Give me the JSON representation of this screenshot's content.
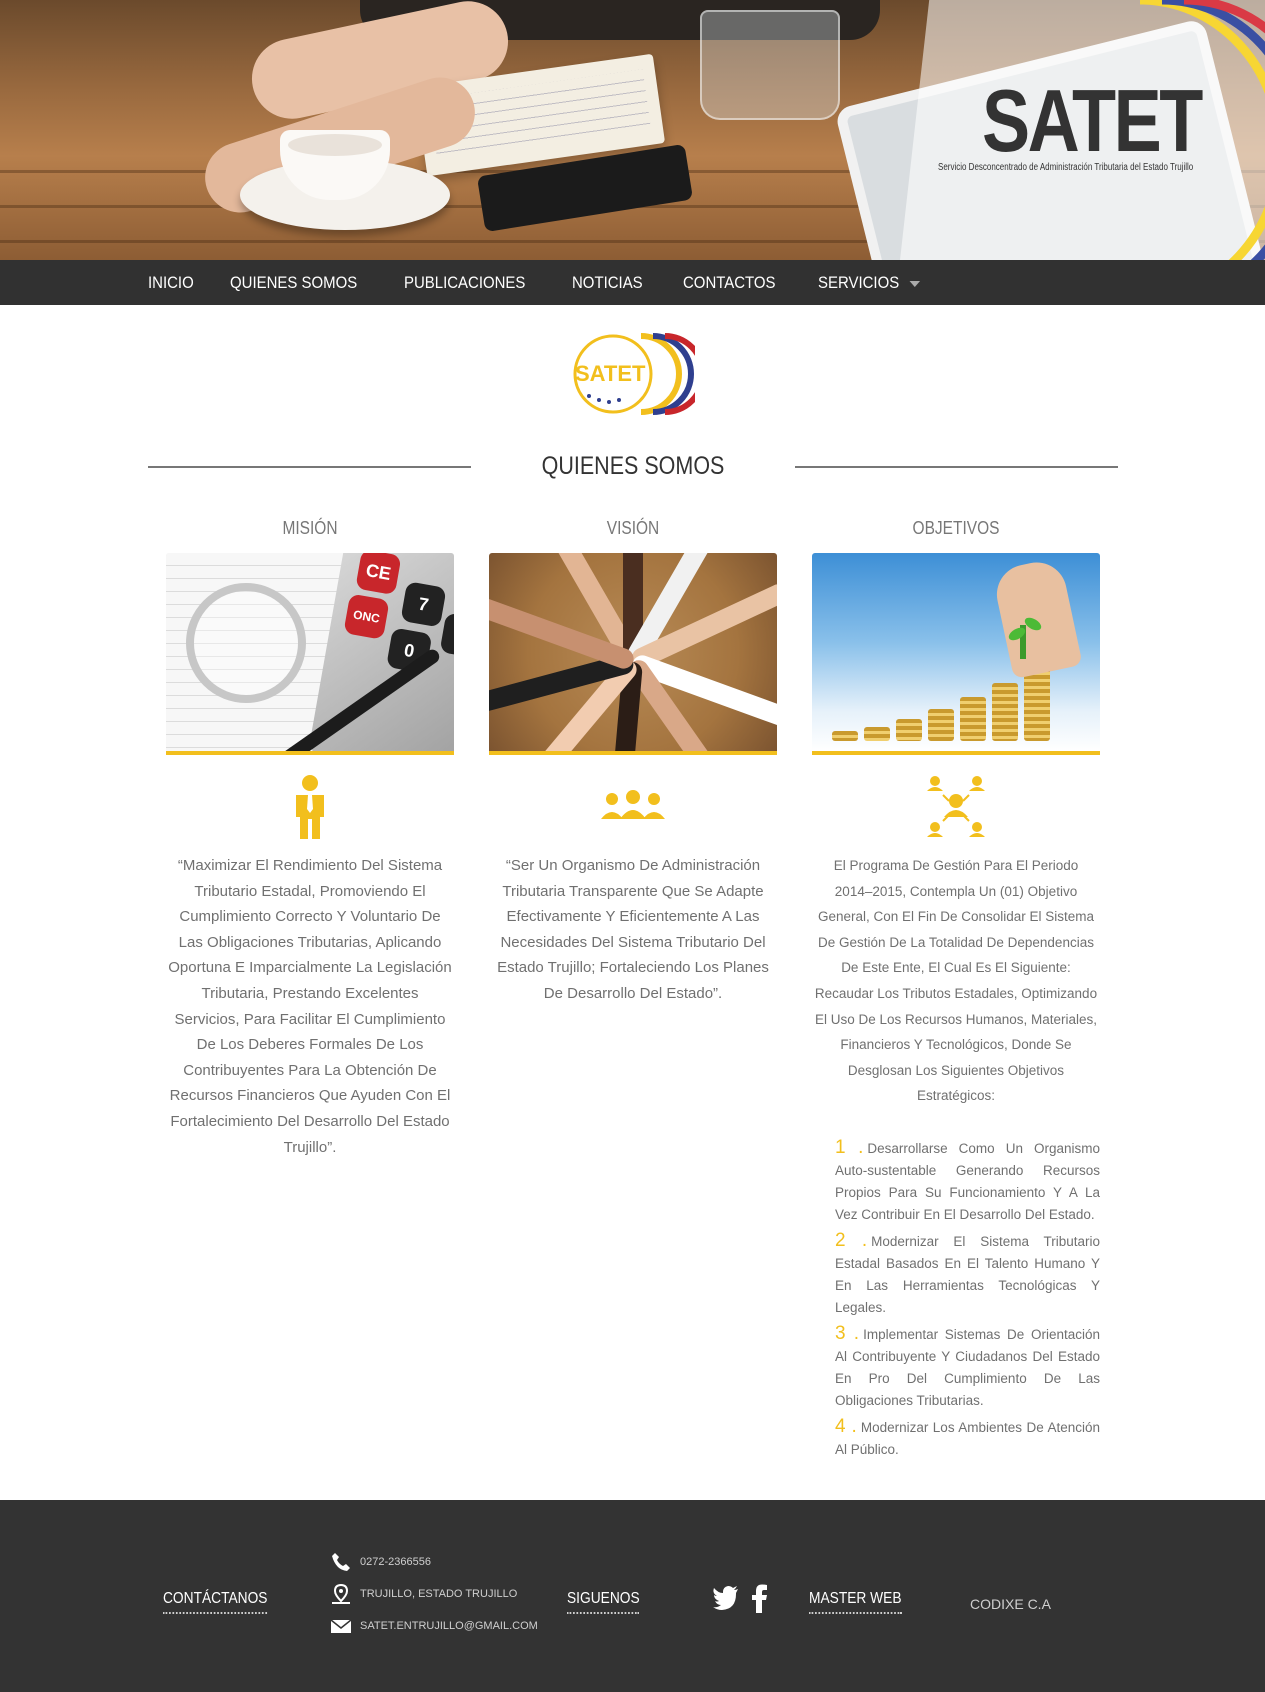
{
  "hero": {
    "brand": "SATET",
    "tagline": "Servicio Desconcentrado de Administración Tributaria del Estado Trujillo"
  },
  "nav": {
    "items": [
      "INICIO",
      "QUIENES SOMOS",
      "PUBLICACIONES",
      "NOTICIAS",
      "CONTACTOS",
      "SERVICIOS"
    ]
  },
  "small_logo": {
    "text": "SATET"
  },
  "section": {
    "title": "QUIENES SOMOS"
  },
  "columns": [
    {
      "title": "MISIÓN",
      "icon": "businessman-icon",
      "text": "“Maximizar El Rendimiento Del Sistema Tributario Estadal, Promoviendo El Cumplimiento Correcto Y Voluntario De Las Obligaciones Tributarias, Aplicando Oportuna E Imparcialmente La Legislación Tributaria, Prestando Excelentes Servicios, Para Facilitar El Cumplimiento De Los Deberes Formales De Los Contribuyentes Para La Obtención De Recursos Financieros Que Ayuden Con El Fortalecimiento Del Desarrollo Del Estado Trujillo”."
    },
    {
      "title": "VISIÓN",
      "icon": "team-icon",
      "text": "“Ser Un Organismo De Administración Tributaria Transparente Que Se Adapte Efectivamente Y Eficientemente A Las Necesidades Del Sistema Tributario Del Estado Trujillo; Fortaleciendo Los Planes De Desarrollo Del Estado”."
    },
    {
      "title": "OBJETIVOS",
      "icon": "network-icon",
      "text": "El Programa De Gestión Para El Periodo 2014–2015, Contempla Un (01) Objetivo General, Con El Fin De Consolidar El Sistema De Gestión De La Totalidad De Dependencias De Este Ente, El Cual Es El Siguiente: Recaudar Los Tributos Estadales, Optimizando El Uso De Los Recursos Humanos, Materiales, Financieros Y Tecnológicos, Donde Se Desglosan Los Siguientes Objetivos Estratégicos:",
      "objectives": [
        {
          "num": "1 .",
          "text": "Desarrollarse Como Un Organismo Auto-sustentable Generando Recursos Propios Para Su Funcionamiento Y A La Vez Contribuir En El Desarrollo Del Estado."
        },
        {
          "num": "2 .",
          "text": "Modernizar El Sistema Tributario Estadal Basados En El Talento Humano Y En Las Herramientas Tecnológicas Y Legales."
        },
        {
          "num": "3 .",
          "text": "Implementar Sistemas De Orientación Al Contribuyente Y Ciudadanos Del Estado En Pro Del Cumplimiento De Las Obligaciones Tributarias."
        },
        {
          "num": "4 .",
          "text": "Modernizar Los Ambientes De Atención Al Público."
        }
      ]
    }
  ],
  "footer": {
    "contact_heading": "CONTÁCTANOS",
    "phone": "0272-2366556",
    "address": "TRUJILLO, ESTADO TRUJILLO",
    "email": "SATET.ENTRUJILLO@GMAIL.COM",
    "follow_heading": "SIGUENOS",
    "social": [
      "twitter-icon",
      "facebook-icon"
    ],
    "master_heading": "MASTER WEB",
    "master_value": "CODIXE C.A"
  },
  "colors": {
    "accent_yellow": "#f2bf1d",
    "nav_bg": "#313131",
    "footer_bg": "#333333",
    "flag_red": "#c8262b",
    "flag_blue": "#2f3f8f"
  }
}
